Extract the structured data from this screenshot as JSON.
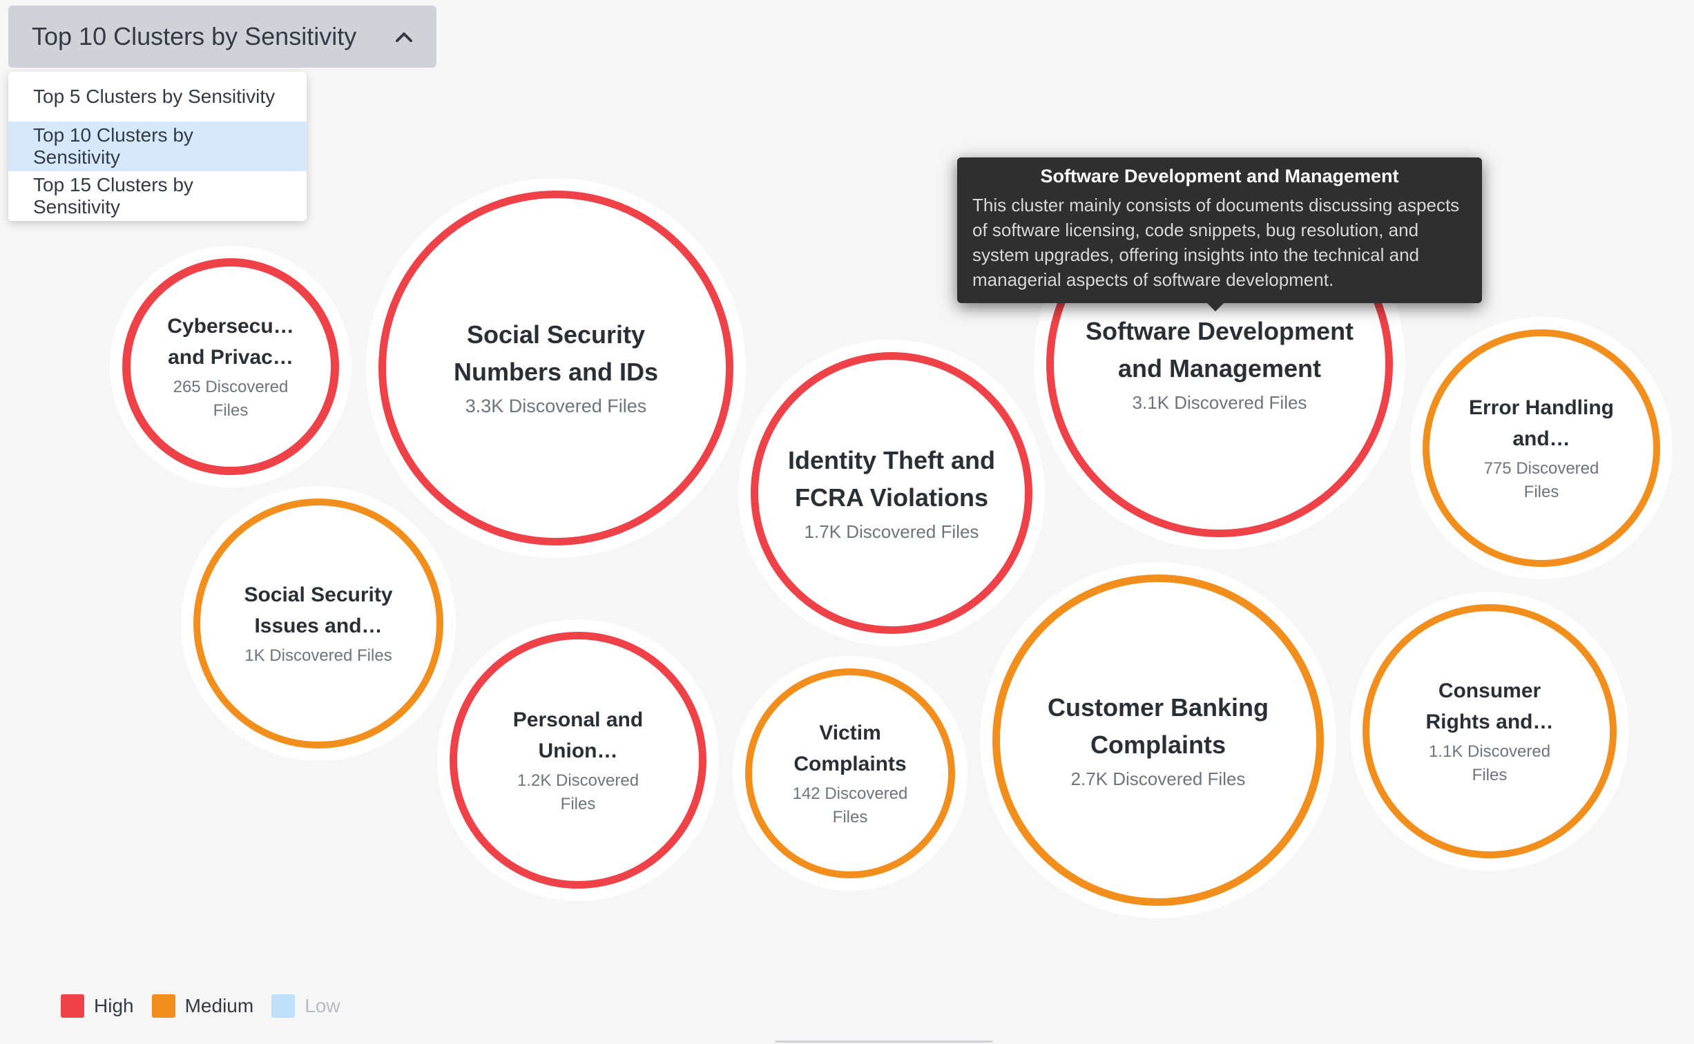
{
  "dropdown": {
    "selected_label": "Top 10 Clusters by Sensitivity",
    "options": [
      {
        "label": "Top 5 Clusters by Sensitivity",
        "selected": false
      },
      {
        "label": "Top 10 Clusters by Sensitivity",
        "selected": true
      },
      {
        "label": "Top 15 Clusters by Sensitivity",
        "selected": false
      }
    ]
  },
  "colors": {
    "high": "#ee4148",
    "medium": "#f28e1c",
    "low": "#bfe0fb"
  },
  "clusters": [
    {
      "title": "Cybersecu… and Privac…",
      "count": "265 Discovered Files",
      "sensitivity": "high"
    },
    {
      "title": "Social Security Numbers and IDs",
      "count": "3.3K Discovered Files",
      "sensitivity": "high"
    },
    {
      "title": "Identity Theft and FCRA Violations",
      "count": "1.7K Discovered Files",
      "sensitivity": "high"
    },
    {
      "title": "Software Development and Management",
      "count": "3.1K Discovered Files",
      "sensitivity": "high"
    },
    {
      "title": "Error Handling and…",
      "count": "775 Discovered Files",
      "sensitivity": "medium"
    },
    {
      "title": "Social Security Issues and…",
      "count": "1K Discovered Files",
      "sensitivity": "medium"
    },
    {
      "title": "Personal and Union…",
      "count": "1.2K Discovered Files",
      "sensitivity": "high"
    },
    {
      "title": "Victim Complaints",
      "count": "142 Discovered Files",
      "sensitivity": "medium"
    },
    {
      "title": "Customer Banking Complaints",
      "count": "2.7K Discovered Files",
      "sensitivity": "medium"
    },
    {
      "title": "Consumer Rights and…",
      "count": "1.1K Discovered Files",
      "sensitivity": "medium"
    }
  ],
  "tooltip": {
    "title": "Software Development and Management",
    "body": "This cluster mainly consists of documents discussing aspects of software licensing, code snippets, bug resolution, and system upgrades, offering insights into the technical and managerial aspects of software development."
  },
  "legend": [
    {
      "label": "High",
      "sensitivity": "high",
      "active": true
    },
    {
      "label": "Medium",
      "sensitivity": "medium",
      "active": true
    },
    {
      "label": "Low",
      "sensitivity": "low",
      "active": false
    }
  ]
}
